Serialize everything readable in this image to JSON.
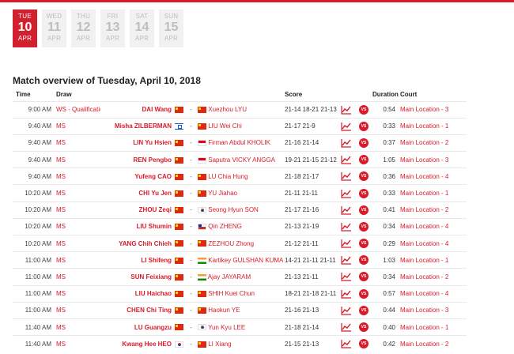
{
  "accent_color": "#d91b29",
  "days": [
    {
      "name": "TUE",
      "num": "10",
      "month": "APR",
      "active": true
    },
    {
      "name": "WED",
      "num": "11",
      "month": "APR",
      "active": false
    },
    {
      "name": "THU",
      "num": "12",
      "month": "APR",
      "active": false
    },
    {
      "name": "FRI",
      "num": "13",
      "month": "APR",
      "active": false
    },
    {
      "name": "SAT",
      "num": "14",
      "month": "APR",
      "active": false
    },
    {
      "name": "SUN",
      "num": "15",
      "month": "APR",
      "active": false
    }
  ],
  "overview_title": "Match overview of Tuesday, April 10, 2018",
  "columns": {
    "time": "Time",
    "draw": "Draw",
    "score": "Score",
    "duration": "Duration",
    "court": "Court"
  },
  "icons": {
    "stats": "stats-chart-icon",
    "vs": "vs-icon",
    "vs_label": "VS"
  },
  "matches": [
    {
      "time": "9:00 AM",
      "draw": "WS - Qualification",
      "p1": "DAI Wang",
      "p1_flag": "cn",
      "dash": "-",
      "p2": "Xuezhou LYU",
      "p2_flag": "cn",
      "score": "21-14 18-21 21-13",
      "duration": "0:54",
      "court": "Main Location - 3"
    },
    {
      "time": "9:40 AM",
      "draw": "MS",
      "p1": "Misha ZILBERMAN",
      "p1_flag": "il",
      "dash": "-",
      "p2": "LIU Wei Chi",
      "p2_flag": "cn",
      "score": "21-17 21-9",
      "duration": "0:33",
      "court": "Main Location - 1"
    },
    {
      "time": "9:40 AM",
      "draw": "MS",
      "p1": "LIN Yu Hsien",
      "p1_flag": "cn",
      "dash": "-",
      "p2": "Firman Abdul KHOLIK",
      "p2_flag": "id",
      "score": "21-16 21-14",
      "duration": "0:37",
      "court": "Main Location - 2"
    },
    {
      "time": "9:40 AM",
      "draw": "MS",
      "p1": "REN Pengbo",
      "p1_flag": "cn",
      "dash": "-",
      "p2": "Saputra VICKY ANGGA",
      "p2_flag": "id",
      "score": "19-21 21-15 21-12",
      "duration": "1:05",
      "court": "Main Location - 3"
    },
    {
      "time": "9:40 AM",
      "draw": "MS",
      "p1": "Yufeng CAO",
      "p1_flag": "cn",
      "dash": "-",
      "p2": "LU Chia Hung",
      "p2_flag": "cn",
      "score": "21-18 21-17",
      "duration": "0:36",
      "court": "Main Location - 4"
    },
    {
      "time": "10:20 AM",
      "draw": "MS",
      "p1": "CHI Yu Jen",
      "p1_flag": "cn",
      "dash": "-",
      "p2": "YU Jiahao",
      "p2_flag": "cn",
      "score": "21-11 21-11",
      "duration": "0:33",
      "court": "Main Location - 1"
    },
    {
      "time": "10:20 AM",
      "draw": "MS",
      "p1": "ZHOU Zeqi",
      "p1_flag": "cn",
      "dash": "-",
      "p2": "Seong Hyun SON",
      "p2_flag": "kr",
      "score": "21-17 21-16",
      "duration": "0:41",
      "court": "Main Location - 2"
    },
    {
      "time": "10:20 AM",
      "draw": "MS",
      "p1": "LIU Shumin",
      "p1_flag": "cn",
      "dash": "-",
      "p2": "Qin ZHENG",
      "p2_flag": "cl",
      "score": "21-13 21-19",
      "duration": "0:34",
      "court": "Main Location - 4"
    },
    {
      "time": "10:20 AM",
      "draw": "MS",
      "p1": "YANG Chih Chieh",
      "p1_flag": "cn",
      "dash": "-",
      "p2": "ZEZHOU Zhong",
      "p2_flag": "cn",
      "score": "21-12 21-11",
      "duration": "0:29",
      "court": "Main Location - 4"
    },
    {
      "time": "11:00 AM",
      "draw": "MS",
      "p1": "LI Shifeng",
      "p1_flag": "cn",
      "dash": "-",
      "p2": "Kartikey GULSHAN KUMAR",
      "p2_flag": "in",
      "score": "14-21 21-11 21-11",
      "duration": "1:03",
      "court": "Main Location - 1"
    },
    {
      "time": "11:00 AM",
      "draw": "MS",
      "p1": "SUN Feixiang",
      "p1_flag": "cn",
      "dash": "-",
      "p2": "Ajay JAYARAM",
      "p2_flag": "in",
      "score": "21-13 21-11",
      "duration": "0:34",
      "court": "Main Location - 2"
    },
    {
      "time": "11:00 AM",
      "draw": "MS",
      "p1": "LIU Haichao",
      "p1_flag": "cn",
      "dash": "-",
      "p2": "SHIH Kuei Chun",
      "p2_flag": "cn",
      "score": "18-21 21-18 21-11",
      "duration": "0:57",
      "court": "Main Location - 4"
    },
    {
      "time": "11:00 AM",
      "draw": "MS",
      "p1": "CHEN Chi Ting",
      "p1_flag": "cn",
      "dash": "-",
      "p2": "Haokun YE",
      "p2_flag": "cn",
      "score": "21-16 21-13",
      "duration": "0:44",
      "court": "Main Location - 3"
    },
    {
      "time": "11:40 AM",
      "draw": "MS",
      "p1": "LU Guangzu",
      "p1_flag": "cn",
      "dash": "-",
      "p2": "Yun Kyu LEE",
      "p2_flag": "kr",
      "score": "21-18 21-14",
      "duration": "0:40",
      "court": "Main Location - 1"
    },
    {
      "time": "11:40 AM",
      "draw": "MS",
      "p1": "Kwang Hee HEO",
      "p1_flag": "kr",
      "dash": "-",
      "p2": "LI Xiang",
      "p2_flag": "cn",
      "score": "21-15 21-13",
      "duration": "0:42",
      "court": "Main Location - 2"
    }
  ]
}
